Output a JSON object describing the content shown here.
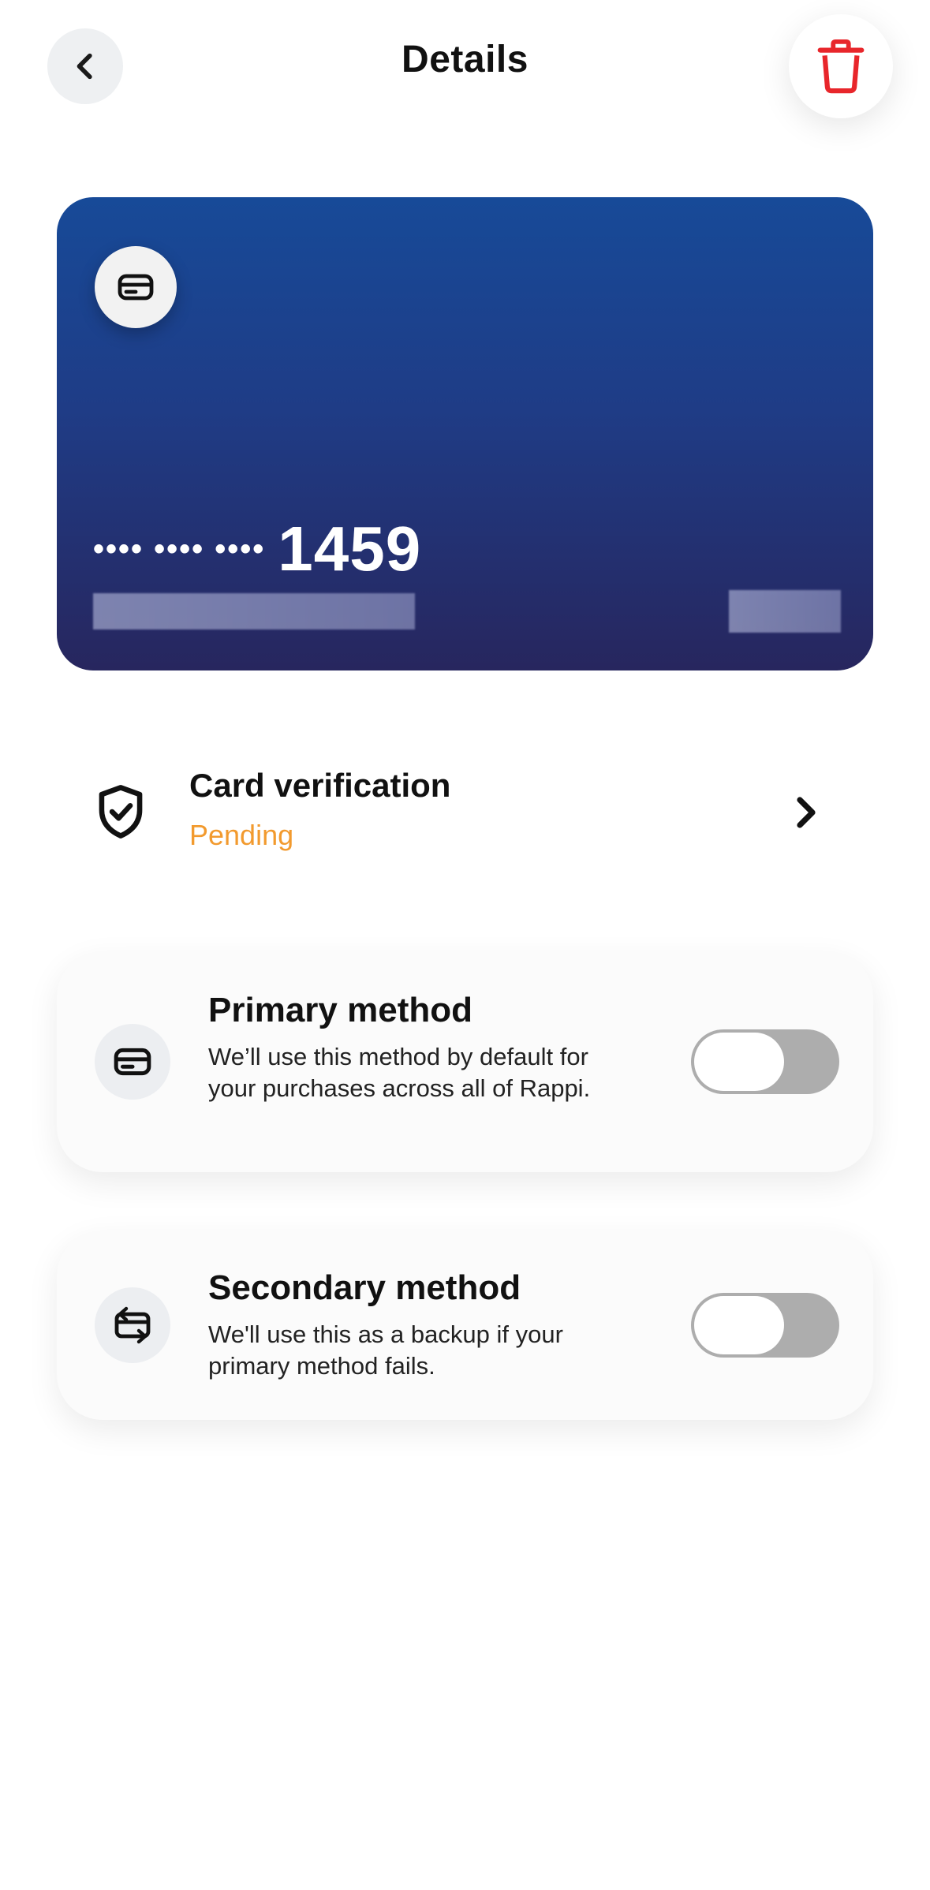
{
  "header": {
    "title": "Details",
    "back_icon": "chevron-left-icon",
    "delete_icon": "trash-icon",
    "delete_color": "#e8262b"
  },
  "card": {
    "masked_groups": "•••• •••• ••••",
    "last4": "1459",
    "icon": "credit-card-icon",
    "gradient_top": "#174a98",
    "gradient_bottom": "#27265e"
  },
  "verification": {
    "title": "Card verification",
    "status": "Pending",
    "status_color": "#f29a2e",
    "icon": "shield-check-icon"
  },
  "primary_method": {
    "title": "Primary method",
    "description": "We’ll use this method by default for your purchases across all of Rappi.",
    "enabled": false,
    "icon": "credit-card-icon"
  },
  "secondary_method": {
    "title": "Secondary method",
    "description": "We'll use this as a backup if your primary method fails.",
    "enabled": false,
    "icon": "card-swap-icon"
  }
}
